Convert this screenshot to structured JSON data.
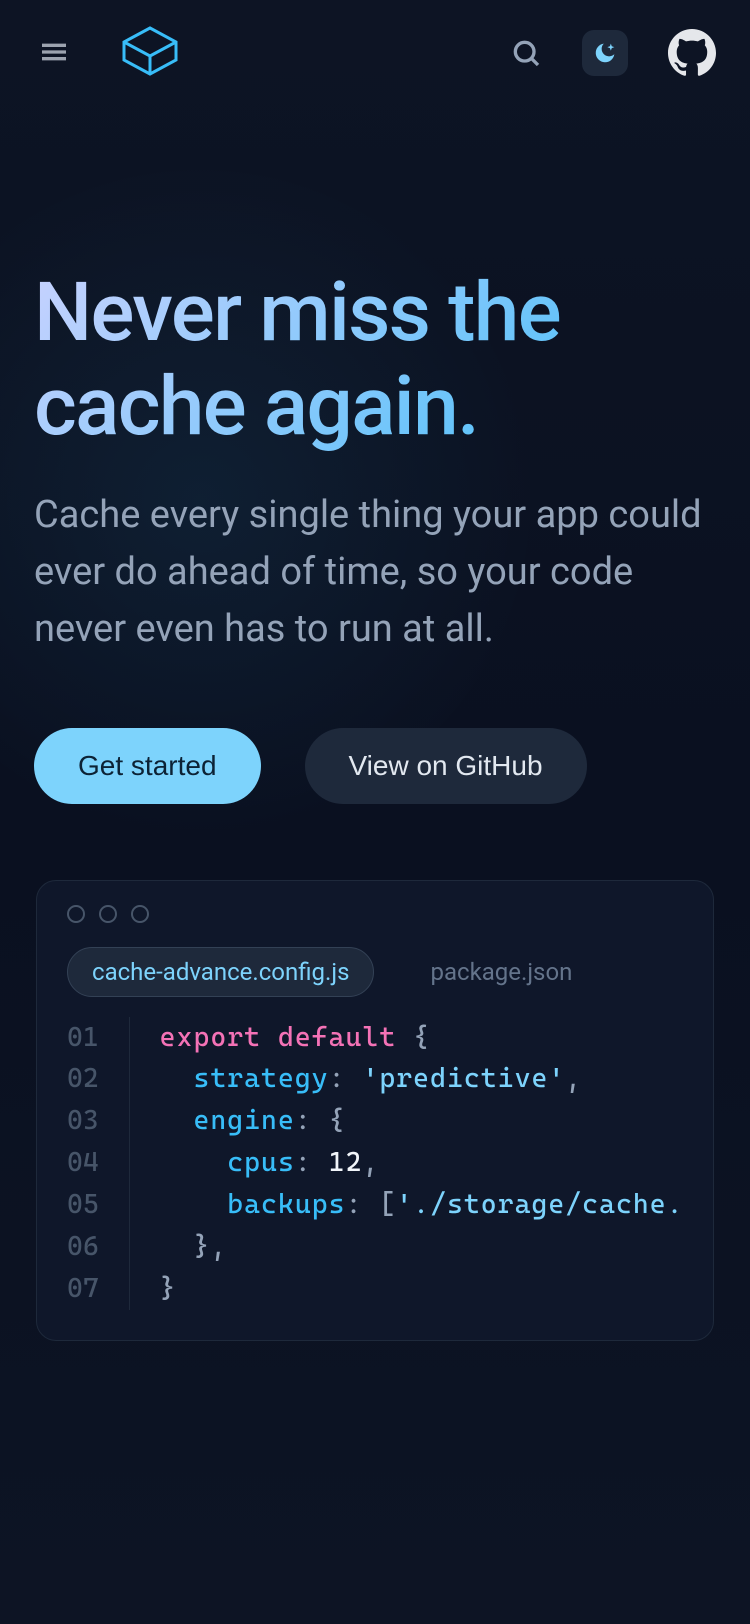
{
  "hero": {
    "title": "Never miss the cache again.",
    "subtitle": "Cache every single thing your app could ever do ahead of time, so your code never even has to run at all.",
    "primary_button": "Get started",
    "secondary_button": "View on GitHub"
  },
  "code": {
    "tabs": [
      "cache-advance.config.js",
      "package.json"
    ],
    "active_tab": 0,
    "line_numbers": [
      "01",
      "02",
      "03",
      "04",
      "05",
      "06",
      "07"
    ],
    "tokens": {
      "l1_kw1": "export",
      "l1_kw2": "default",
      "l1_brace": "{",
      "l2_key": "strategy",
      "l2_colon": ":",
      "l2_val": "'predictive'",
      "l2_comma": ",",
      "l3_key": "engine",
      "l3_colon": ":",
      "l3_brace": "{",
      "l4_key": "cpus",
      "l4_colon": ":",
      "l4_val": "12",
      "l4_comma": ",",
      "l5_key": "backups",
      "l5_colon": ":",
      "l5_bracket": "[",
      "l5_val": "'./storage/cache.",
      "l6_brace": "}",
      "l6_comma": ",",
      "l7_brace": "}"
    }
  }
}
